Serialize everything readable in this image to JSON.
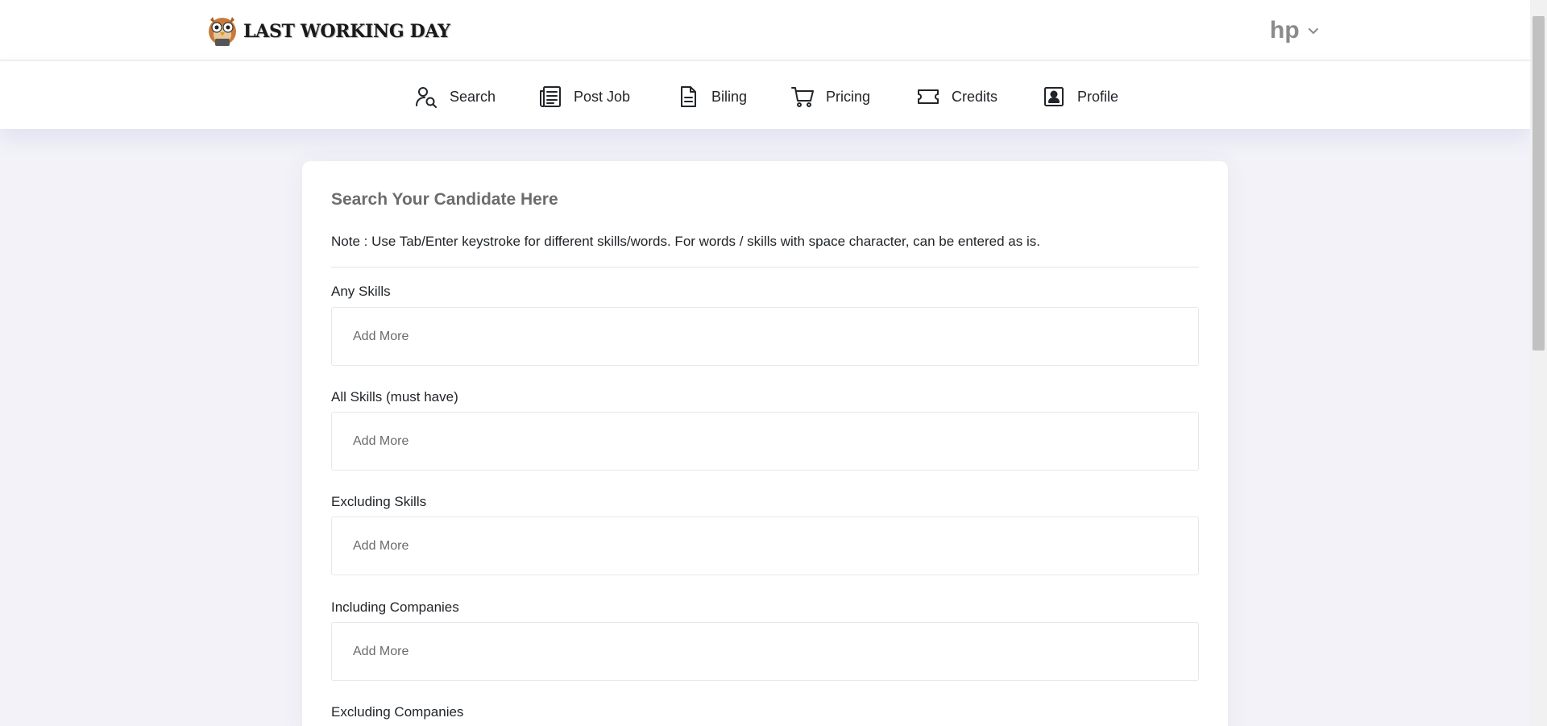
{
  "app": {
    "brand_name": "LAST WORKING DAY"
  },
  "user": {
    "name": "hp"
  },
  "nav": {
    "items": [
      {
        "label": "Search",
        "icon": "user-search-icon"
      },
      {
        "label": "Post Job",
        "icon": "newspaper-icon"
      },
      {
        "label": "Biling",
        "icon": "document-icon"
      },
      {
        "label": "Pricing",
        "icon": "cart-icon"
      },
      {
        "label": "Credits",
        "icon": "ticket-icon"
      },
      {
        "label": "Profile",
        "icon": "profile-card-icon"
      }
    ]
  },
  "search": {
    "title": "Search Your Candidate Here",
    "note": "Note : Use Tab/Enter keystroke for different skills/words. For words / skills with space character, can be entered as is.",
    "fields": [
      {
        "label": "Any Skills",
        "placeholder": "Add More"
      },
      {
        "label": "All Skills (must have)",
        "placeholder": "Add More"
      },
      {
        "label": "Excluding Skills",
        "placeholder": "Add More"
      },
      {
        "label": "Including Companies",
        "placeholder": "Add More"
      },
      {
        "label": "Excluding Companies"
      }
    ]
  },
  "colors": {
    "accent": "#1a1a1a",
    "background": "#f2f2f8",
    "card": "#ffffff"
  }
}
